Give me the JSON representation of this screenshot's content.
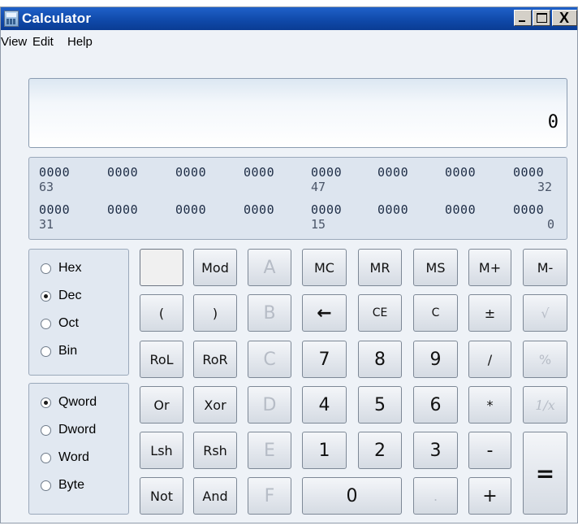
{
  "window": {
    "title": "Calculator"
  },
  "titlebar": {
    "close_glyph": "X"
  },
  "menu": [
    "View",
    "Edit",
    "Help"
  ],
  "display": {
    "value": "0"
  },
  "bits": {
    "row1_groups": [
      "0000",
      "0000",
      "0000",
      "0000",
      "0000",
      "0000",
      "0000",
      "0000"
    ],
    "row1_labels": [
      "63",
      "47",
      "32"
    ],
    "row2_groups": [
      "0000",
      "0000",
      "0000",
      "0000",
      "0000",
      "0000",
      "0000",
      "0000"
    ],
    "row2_labels": [
      "31",
      "15",
      "0"
    ]
  },
  "base_options": [
    {
      "label": "Hex",
      "selected": false
    },
    {
      "label": "Dec",
      "selected": true
    },
    {
      "label": "Oct",
      "selected": false
    },
    {
      "label": "Bin",
      "selected": false
    }
  ],
  "word_options": [
    {
      "label": "Qword",
      "selected": true
    },
    {
      "label": "Dword",
      "selected": false
    },
    {
      "label": "Word",
      "selected": false
    },
    {
      "label": "Byte",
      "selected": false
    }
  ],
  "keys": {
    "blank": "",
    "mod": "Mod",
    "a": "A",
    "mc": "MC",
    "mr": "MR",
    "ms": "MS",
    "mplus": "M+",
    "mminus": "M-",
    "lparen": "(",
    "rparen": ")",
    "b": "B",
    "back": "←",
    "ce": "CE",
    "c": "C",
    "plusminus": "±",
    "sqrt": "√",
    "rol": "RoL",
    "ror": "RoR",
    "cc": "C",
    "k7": "7",
    "k8": "8",
    "k9": "9",
    "div": "/",
    "pct": "%",
    "or": "Or",
    "xor": "Xor",
    "d": "D",
    "k4": "4",
    "k5": "5",
    "k6": "6",
    "mul": "*",
    "recip": "1/x",
    "lsh": "Lsh",
    "rsh": "Rsh",
    "e": "E",
    "k1": "1",
    "k2": "2",
    "k3": "3",
    "minus": "-",
    "eq": "=",
    "not": "Not",
    "and": "And",
    "f": "F",
    "k0": "0",
    "dot": ".",
    "plus": "+"
  },
  "colors": {
    "title_bar": "#0f48a8",
    "window_bg": "#eef2f7",
    "panel_bg": "#dde5ef"
  }
}
